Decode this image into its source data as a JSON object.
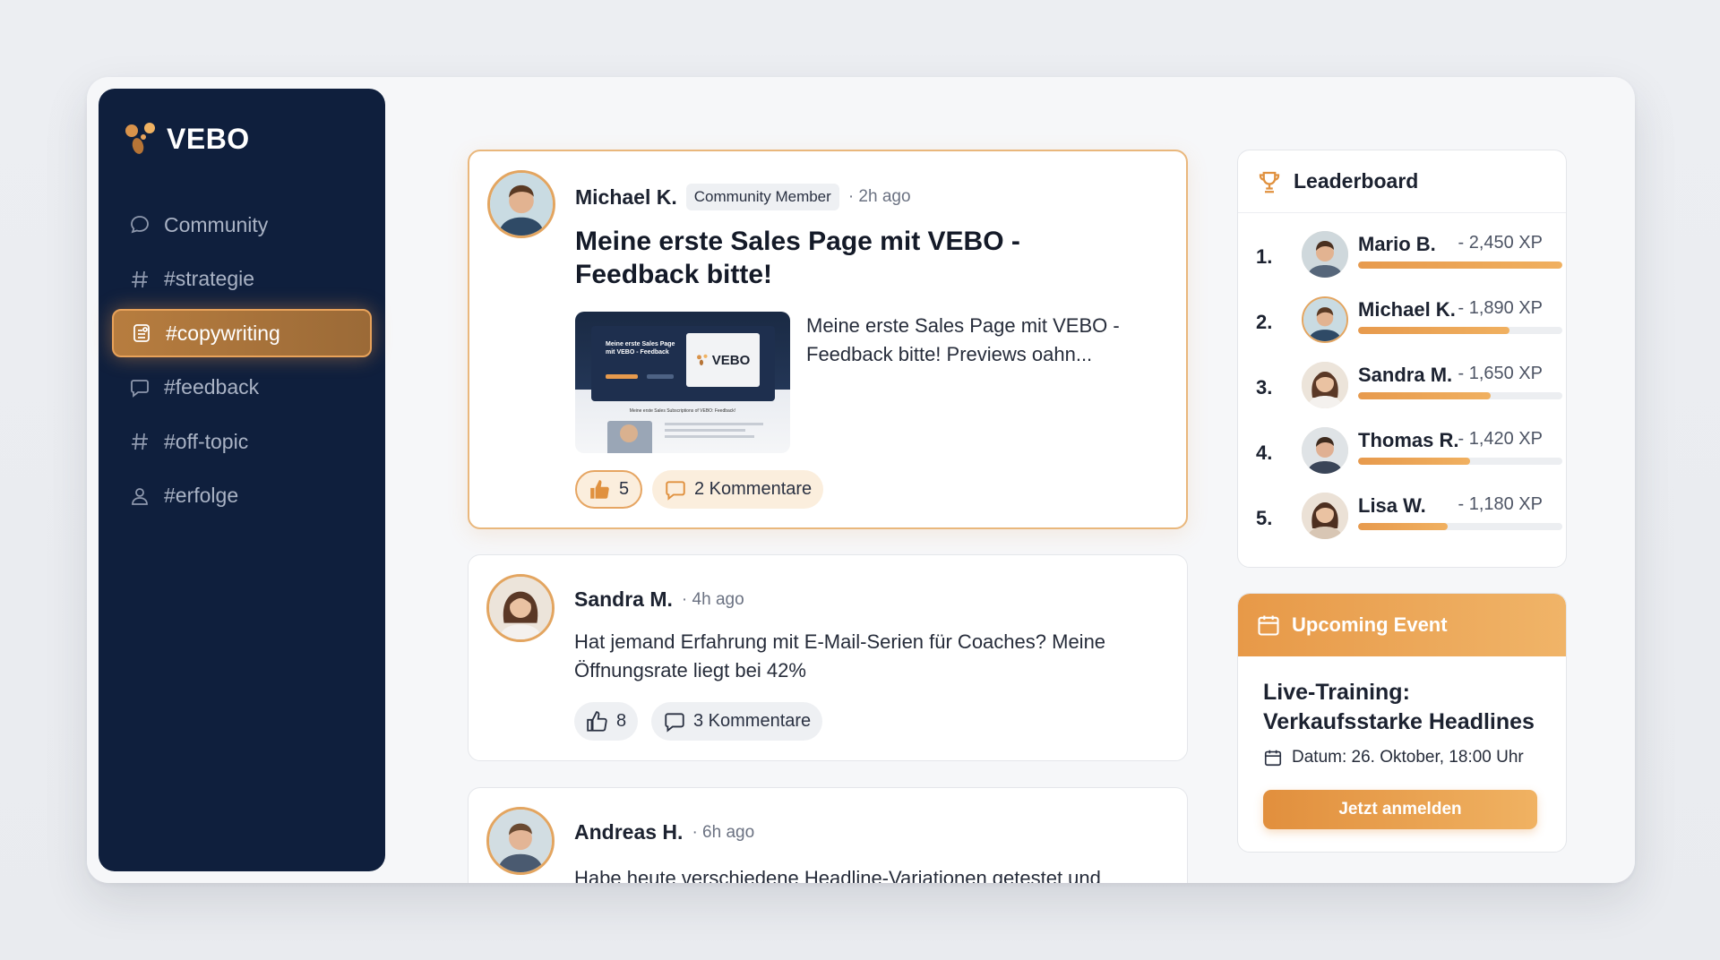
{
  "brand": {
    "name": "VEBO",
    "accent": "#e79a4d",
    "sidebar_bg": "#0f1f3d"
  },
  "sidebar": {
    "items": [
      {
        "label": "Community",
        "icon": "chat-bubble-icon",
        "active": false
      },
      {
        "label": "#strategie",
        "icon": "hash-icon",
        "active": false
      },
      {
        "label": "#copywriting",
        "icon": "document-edit-icon",
        "active": true
      },
      {
        "label": "#feedback",
        "icon": "chat-square-icon",
        "active": false
      },
      {
        "label": "#off-topic",
        "icon": "hash-icon",
        "active": false
      },
      {
        "label": "#erfolge",
        "icon": "user-icon",
        "active": false
      }
    ]
  },
  "posts": [
    {
      "author": "Michael K.",
      "badge": "Community Member",
      "time": "· 2h ago",
      "title": "Meine erste Sales Page mit VEBO - Feedback bitte!",
      "preview": "Meine erste Sales Page mit VEBO - Feedback bitte! Previews oahn...",
      "thumbnail": {
        "headline": "Meine erste Sales Page mit VEBO - Feedback",
        "logo": "VEBO",
        "subline": "Meine erste Sales Subscriptions of VEBO: Feedback!"
      },
      "likes": "5",
      "comments": "2 Kommentare"
    },
    {
      "author": "Sandra M.",
      "time": "· 4h ago",
      "body": "Hat jemand Erfahrung mit E-Mail-Serien für Coaches? Meine Öffnungsrate liegt bei 42%",
      "likes": "8",
      "comments": "3 Kommentare"
    },
    {
      "author": "Andreas H.",
      "time": "· 6h ago",
      "body": "Habe heute verschiedene Headline-Variationen getestet und"
    }
  ],
  "leaderboard": {
    "title": "Leaderboard",
    "entries": [
      {
        "rank": "1.",
        "name": "Mario B.",
        "xp": "- 2,450 XP",
        "progress": 1.0
      },
      {
        "rank": "2.",
        "name": "Michael K.",
        "xp": "- 1,890 XP",
        "progress": 0.74
      },
      {
        "rank": "3.",
        "name": "Sandra M.",
        "xp": "- 1,650 XP",
        "progress": 0.65
      },
      {
        "rank": "4.",
        "name": "Thomas R.",
        "xp": "- 1,420 XP",
        "progress": 0.55
      },
      {
        "rank": "5.",
        "name": "Lisa W.",
        "xp": "- 1,180 XP",
        "progress": 0.44
      }
    ]
  },
  "event": {
    "header": "Upcoming Event",
    "title": "Live-Training: Verkaufsstarke Headlines",
    "date": "Datum: 26. Oktober, 18:00 Uhr",
    "button": "Jetzt anmelden"
  }
}
